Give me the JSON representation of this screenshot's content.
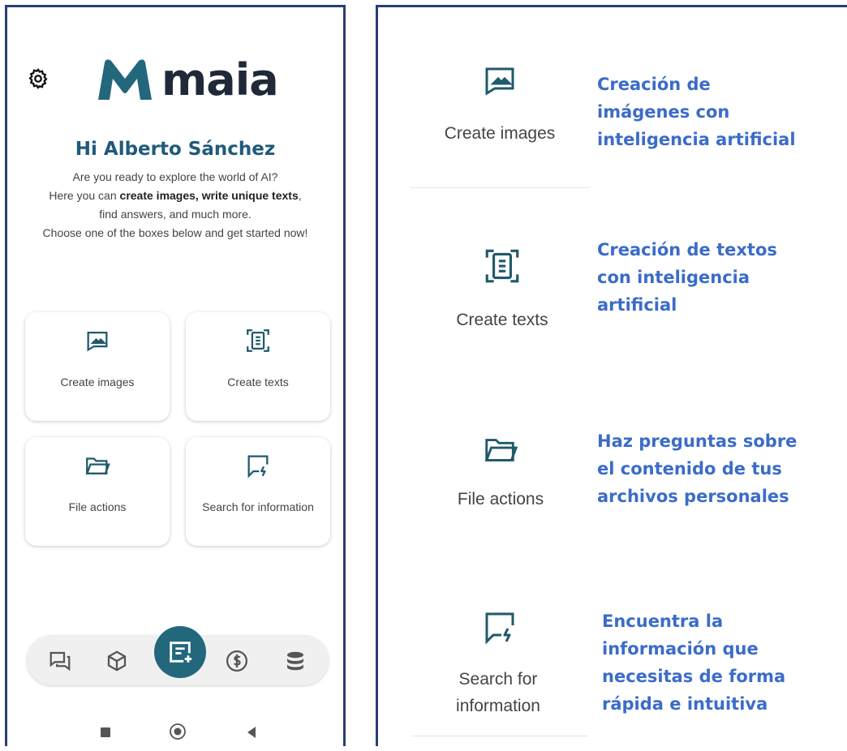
{
  "app": {
    "brand": "maia",
    "accent": "#23677d",
    "greeting": "Hi Alberto Sánchez",
    "intro": {
      "line1": "Are you ready to explore the world of AI?",
      "line2_prefix": "Here you can ",
      "line2_bold": "create images, write unique texts",
      "line2_suffix": ",",
      "line3": "find answers, and much more.",
      "line4": "Choose one of the boxes below and get started now!"
    },
    "cards": [
      {
        "label": "Create images",
        "icon": "image-icon"
      },
      {
        "label": "Create texts",
        "icon": "document-scan-icon"
      },
      {
        "label": "File actions",
        "icon": "folder-icon"
      },
      {
        "label": "Search for information",
        "icon": "chat-bolt-icon"
      }
    ],
    "bottom_nav": [
      "chat-icon",
      "cube-icon",
      "new-note-icon",
      "dollar-icon",
      "database-icon"
    ],
    "system_nav": [
      "stop-icon",
      "home-icon",
      "back-icon"
    ]
  },
  "explanations": [
    {
      "label": "Create images",
      "description_lines": [
        "Creación de",
        "imágenes con",
        "inteligencia artificial"
      ]
    },
    {
      "label": "Create texts",
      "description_lines": [
        "Creación de textos",
        "con inteligencia",
        "artificial"
      ]
    },
    {
      "label": "File actions",
      "description_lines": [
        "Haz preguntas sobre",
        "el contenido de tus",
        "archivos personales"
      ]
    },
    {
      "label_lines": [
        "Search for",
        "information"
      ],
      "description_lines": [
        "Encuentra la",
        "información que",
        "necesitas de forma",
        "rápida e intuitiva"
      ]
    }
  ],
  "colors": {
    "frame": "#2b3d73",
    "description": "#3b6cc8",
    "icon": "#1f5a6a"
  }
}
